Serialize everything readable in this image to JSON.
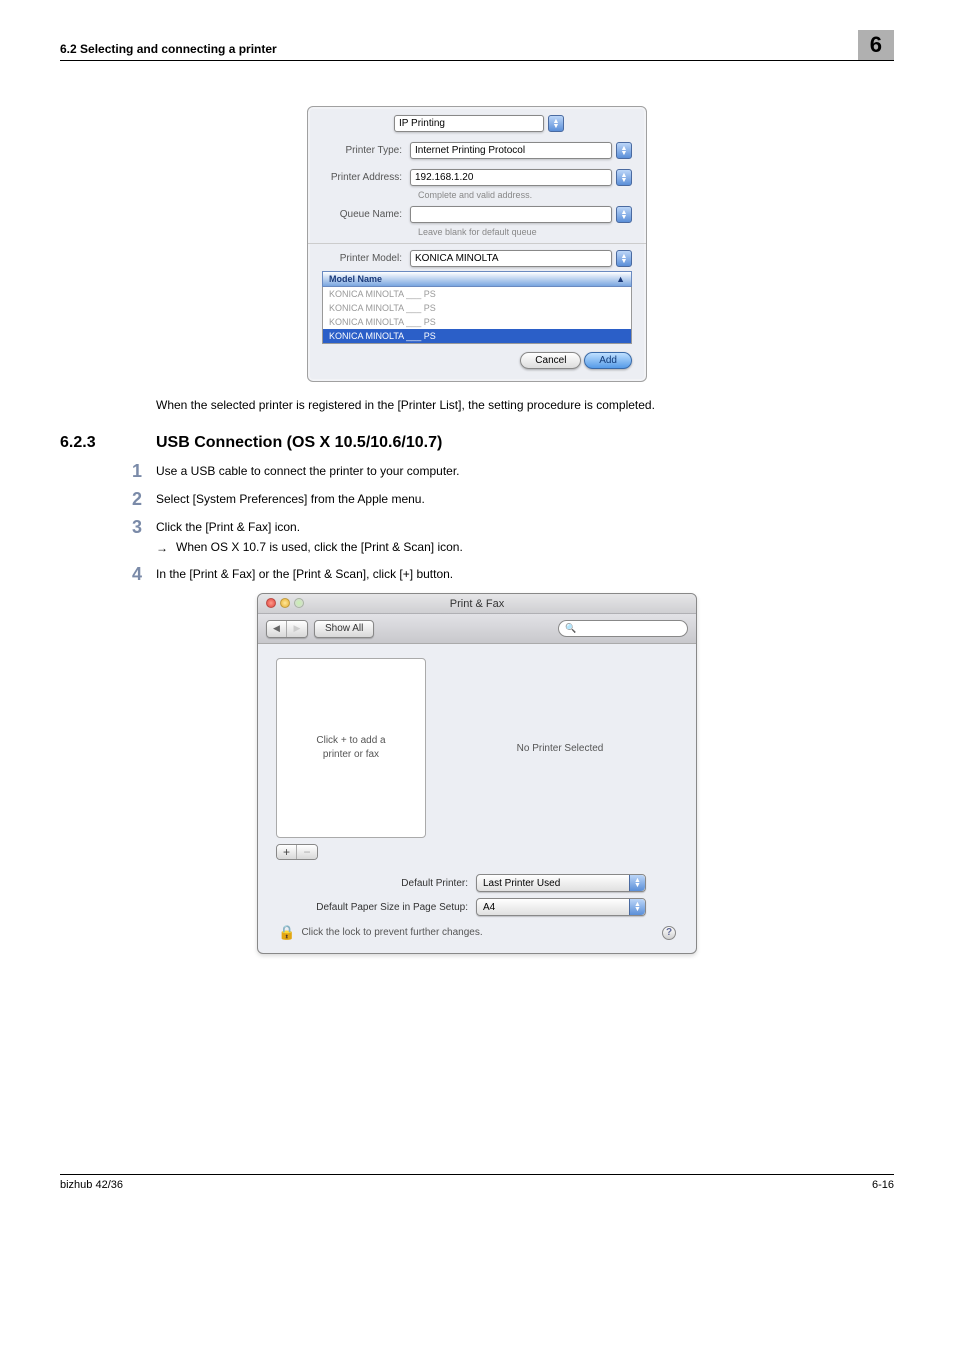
{
  "header": {
    "section_left": "6.2    Selecting and connecting a printer",
    "chapter_number": "6"
  },
  "dialog1": {
    "tab": "IP Printing",
    "type_label": "Printer Type:",
    "type_value": "Internet Printing Protocol",
    "address_label": "Printer Address:",
    "address_value": "192.168.1.20",
    "address_helper": "Complete and valid address.",
    "queue_label": "Queue Name:",
    "queue_value": "",
    "queue_helper": "Leave blank for default queue",
    "model_label": "Printer Model:",
    "model_value": "KONICA MINOLTA",
    "table_header": "Model Name",
    "rows": [
      "KONICA MINOLTA ___ PS",
      "KONICA MINOLTA ___ PS",
      "KONICA MINOLTA ___ PS",
      "KONICA MINOLTA ___ PS"
    ],
    "cancel": "Cancel",
    "add": "Add"
  },
  "body_text_1": "When the selected printer is registered in the [Printer List], the setting procedure is completed.",
  "section": {
    "number": "6.2.3",
    "title": "USB Connection (OS X 10.5/10.6/10.7)"
  },
  "steps": {
    "s1": "Use a USB cable to connect the printer to your computer.",
    "s2": "Select [System Preferences] from the Apple menu.",
    "s3": "Click the [Print & Fax] icon.",
    "s3_sub": "When OS X 10.7 is used, click the [Print & Scan] icon.",
    "s4": "In the [Print & Fax] or the [Print & Scan], click [+] button."
  },
  "dialog2": {
    "title": "Print & Fax",
    "showall": "Show All",
    "list_placeholder_l1": "Click + to add a",
    "list_placeholder_l2": "printer or fax",
    "no_printer": "No Printer Selected",
    "def_printer_lbl": "Default Printer:",
    "def_printer_val": "Last Printer Used",
    "def_paper_lbl": "Default Paper Size in Page Setup:",
    "def_paper_val": "A4",
    "lock_text": "Click the lock to prevent further changes."
  },
  "footer": {
    "left": "bizhub 42/36",
    "right": "6-16"
  }
}
